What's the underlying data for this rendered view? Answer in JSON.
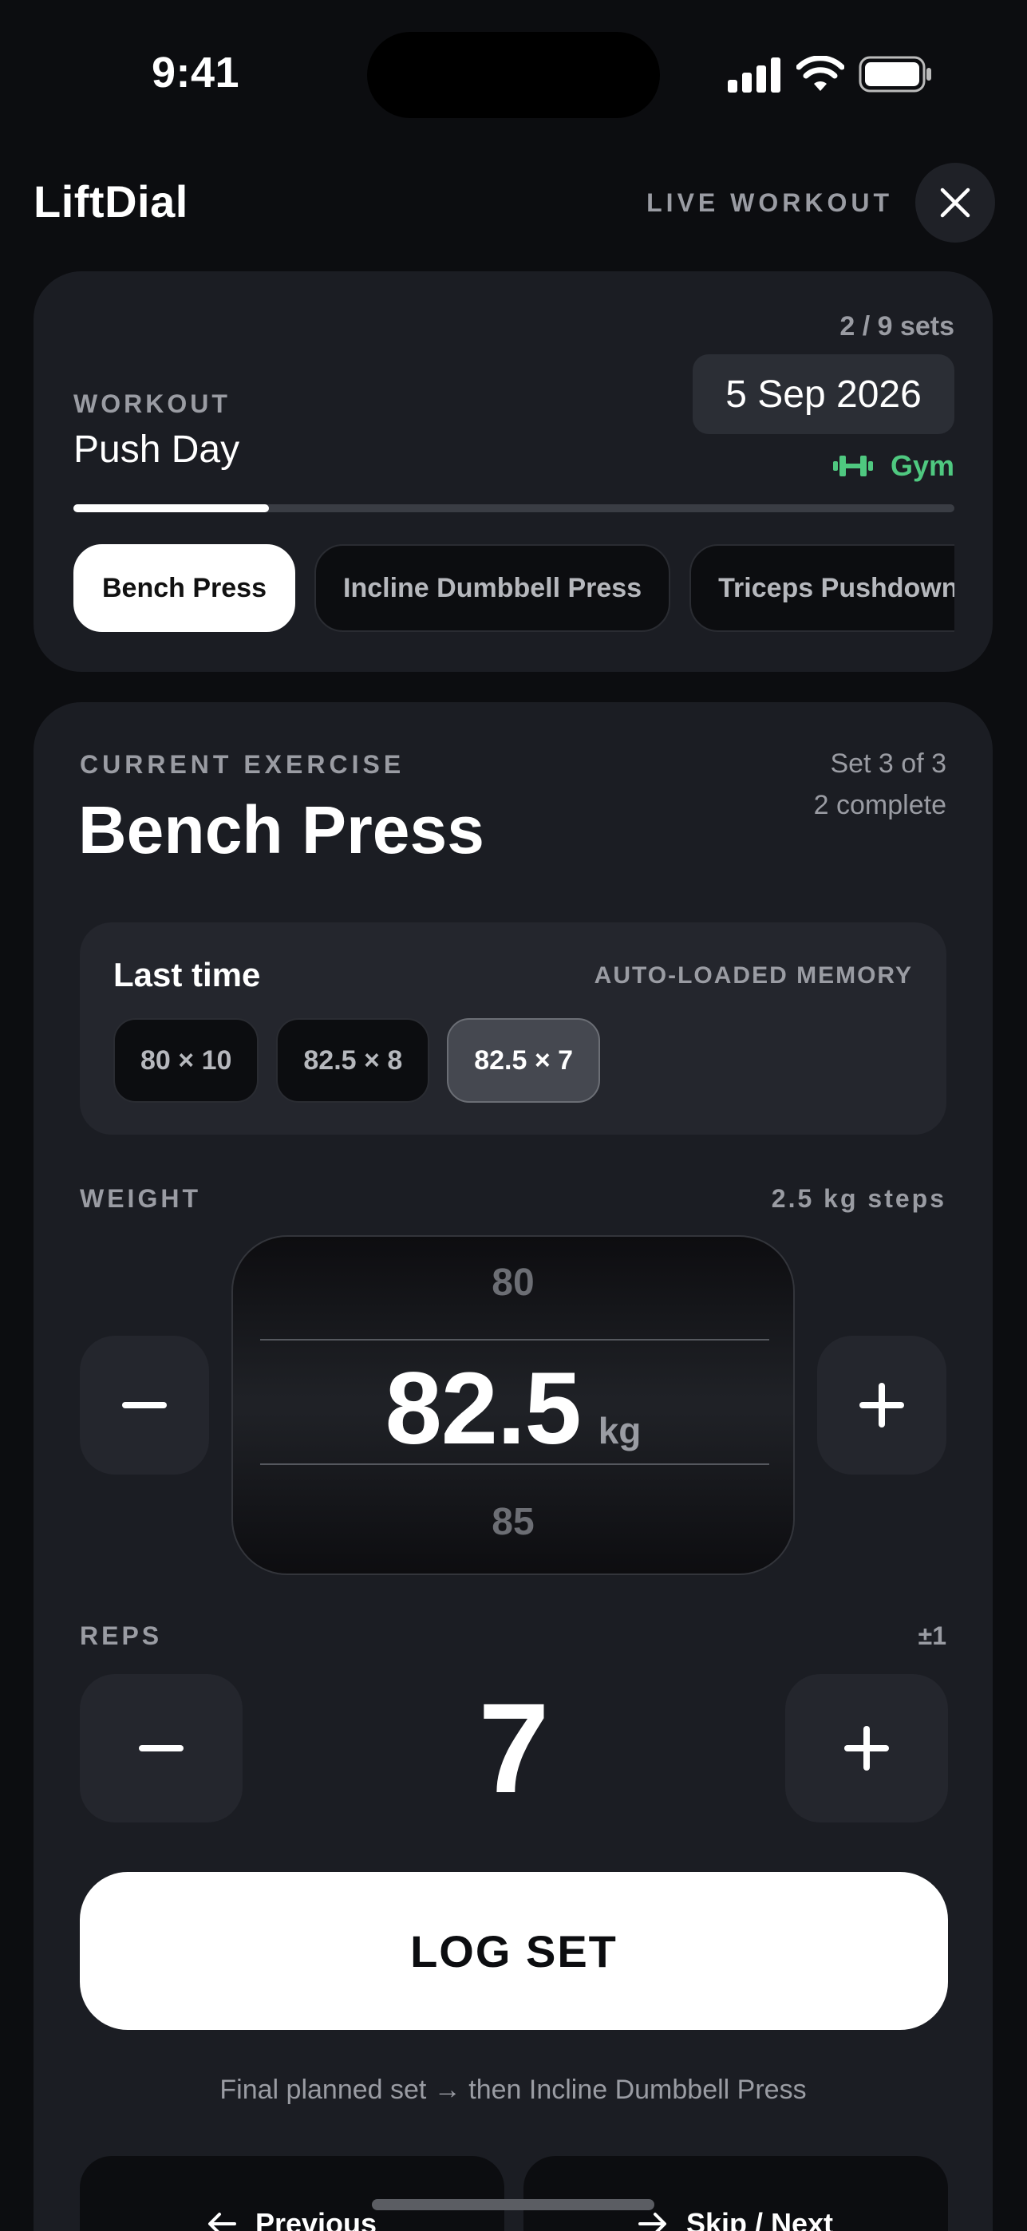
{
  "status_bar": {
    "time": "9:41"
  },
  "header": {
    "app_title": "LiftDial",
    "mode_label": "LIVE WORKOUT"
  },
  "workout": {
    "sets_progress": "2 / 9 sets",
    "label": "WORKOUT",
    "name": "Push Day",
    "date": "5 Sep 2026",
    "location": "Gym",
    "progress_fraction": 0.222,
    "exercises": [
      {
        "label": "Bench Press",
        "active": true
      },
      {
        "label": "Incline Dumbbell Press",
        "active": false
      },
      {
        "label": "Triceps Pushdown",
        "active": false
      }
    ]
  },
  "exercise": {
    "section_label": "CURRENT EXERCISE",
    "name": "Bench Press",
    "set_position": "Set 3 of 3",
    "completed": "2 complete",
    "last_time": {
      "title": "Last time",
      "tag": "AUTO-LOADED MEMORY",
      "sets": [
        "80 × 10",
        "82.5 × 8",
        "82.5 × 7"
      ],
      "selected_index": 2
    },
    "weight": {
      "label": "WEIGHT",
      "step_label": "2.5 kg steps",
      "prev": "80",
      "value": "82.5",
      "unit": "kg",
      "next": "85"
    },
    "reps": {
      "label": "REPS",
      "step_label": "±1",
      "value": "7"
    },
    "log_label": "LOG SET",
    "hint": "Final planned set → then Incline Dumbbell Press",
    "prev_label": "Previous",
    "next_label": "Skip / Next"
  },
  "colors": {
    "accent_green": "#4fc880",
    "card": "#1b1d23",
    "background": "#0c0d10"
  }
}
